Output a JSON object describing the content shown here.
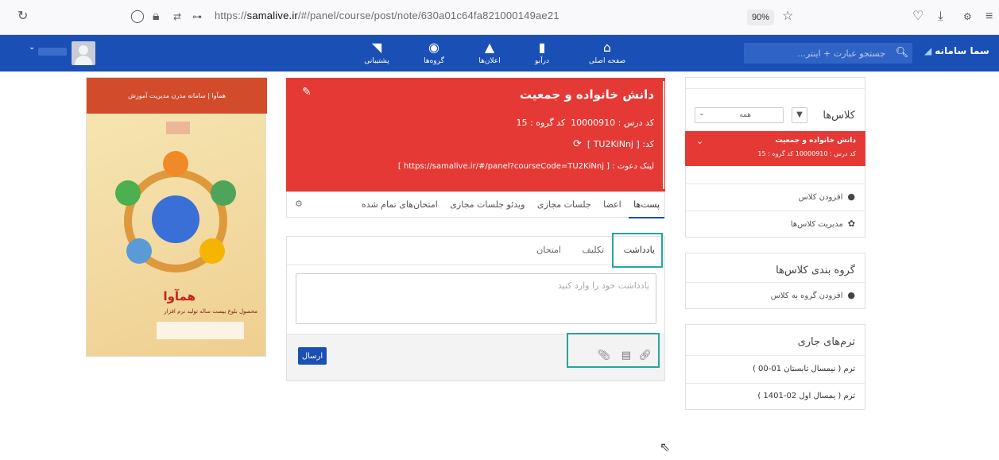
{
  "browser": {
    "url_prefix": "https://",
    "url_host": "samalive.ir",
    "url_path": "/#/panel/course/post/note/630a01c64fa821000149ae21",
    "zoom": "90%"
  },
  "navbar": {
    "brand": "سما سامانه",
    "search_placeholder": "جستجو عبارت + اینتر...",
    "items": [
      {
        "label": "صفحه اصلی",
        "icon": "home-icon"
      },
      {
        "label": "درآبو",
        "icon": "book-icon"
      },
      {
        "label": "اعلان‌ها",
        "icon": "bell-icon"
      },
      {
        "label": "گروه‌ها",
        "icon": "globe-icon"
      },
      {
        "label": "پشتیبانی",
        "icon": "rss-icon"
      }
    ]
  },
  "poster": {
    "banner": "همآوا | سامانه مدرن مدیریت آموزش",
    "title": "همآوا",
    "subtitle": "محصول بلوغ بیست ساله تولید نرم افزار"
  },
  "course": {
    "title": "دانش خانواده و جمعیت",
    "code_label": "کد درس : 10000910",
    "group_label": "کد گروه : 15",
    "class_code": "کد: [ TU2KiNnj ]",
    "invite": "لینک دعوت : [ https://samalive.ir/#/panel?courseCode=TU2KiNnj ]",
    "tabs": [
      "پست‌ها",
      "اعضا",
      "جلسات مجازی",
      "ویدئو جلسات مجازی",
      "امتحان‌های تمام شده"
    ]
  },
  "note": {
    "tabs": [
      "یادداشت",
      "تکلیف",
      "امتحان"
    ],
    "placeholder": "یادداشت خود را وارد کنید",
    "send": "ارسال"
  },
  "sidebar": {
    "classes_title": "کلاس‌ها",
    "filter_value": "همه",
    "active_class_title": "دانش خانواده و جمعیت",
    "active_class_sub": "کد درس : 10000910   کد گروه : 15",
    "add_class": "افزودن کلاس",
    "manage_classes": "مدیریت کلاس‌ها",
    "grouping_title": "گروه بندی کلاس‌ها",
    "add_group": "افزودن گروه به کلاس",
    "terms_title": "ترم‌های جاری",
    "terms": [
      "ترم ( نیمسال تابستان 01-00 )",
      "ترم ( یمسال اول 02-1401 )"
    ]
  },
  "colors": {
    "primary": "#1a4fb5",
    "course_red": "#e53935",
    "highlight": "#26a69a"
  }
}
